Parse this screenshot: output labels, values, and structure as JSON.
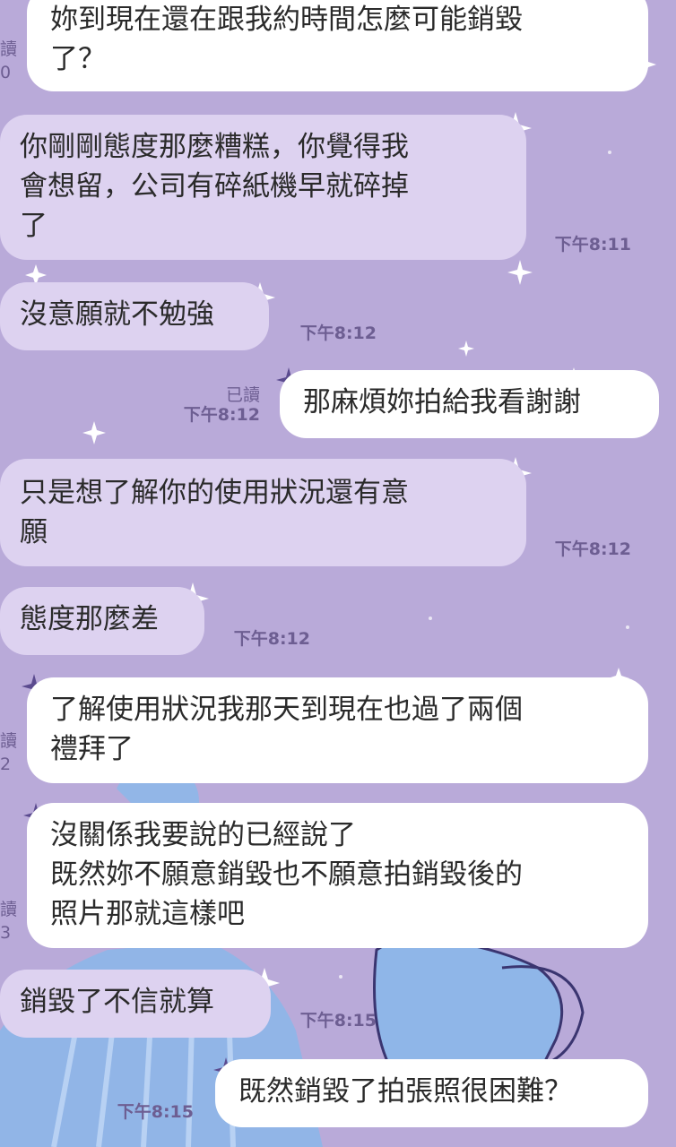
{
  "messages": [
    {
      "dir": "out",
      "text": "妳到現在還在跟我約時間怎麼可能銷毀\n了？",
      "time": "",
      "read": ""
    },
    {
      "dir": "in",
      "text": "你剛剛態度那麼糟糕，你覺得我\n會想留，公司有碎紙機早就碎掉\n了",
      "time": "下午8:11",
      "read": ""
    },
    {
      "dir": "in",
      "text": "沒意願就不勉強",
      "time": "下午8:12",
      "read": ""
    },
    {
      "dir": "out",
      "text": "那麻煩妳拍給我看謝謝",
      "time": "下午8:12",
      "read": "已讀"
    },
    {
      "dir": "in",
      "text": "只是想了解你的使用狀況還有意\n願",
      "time": "下午8:12",
      "read": ""
    },
    {
      "dir": "in",
      "text": "態度那麼差",
      "time": "下午8:12",
      "read": ""
    },
    {
      "dir": "out",
      "text": "了解使用狀況我那天到現在也過了兩個\n禮拜了",
      "time": "",
      "read": ""
    },
    {
      "dir": "out",
      "text": "沒關係我要說的已經說了\n既然妳不願意銷毀也不願意拍銷毀後的\n照片那就這樣吧",
      "time": "",
      "read": ""
    },
    {
      "dir": "in",
      "text": "銷毀了不信就算",
      "time": "下午8:15",
      "read": ""
    },
    {
      "dir": "out",
      "text": "既然銷毀了拍張照很困難？",
      "time": "下午8:15",
      "read": ""
    }
  ],
  "edge_fragments": [
    "讀",
    "0",
    "讀",
    "2",
    "讀",
    "3"
  ],
  "colors": {
    "background": "#b9aad9",
    "incoming": "#ddd2f0",
    "outgoing": "#ffffff",
    "meta": "#6d5e92"
  }
}
